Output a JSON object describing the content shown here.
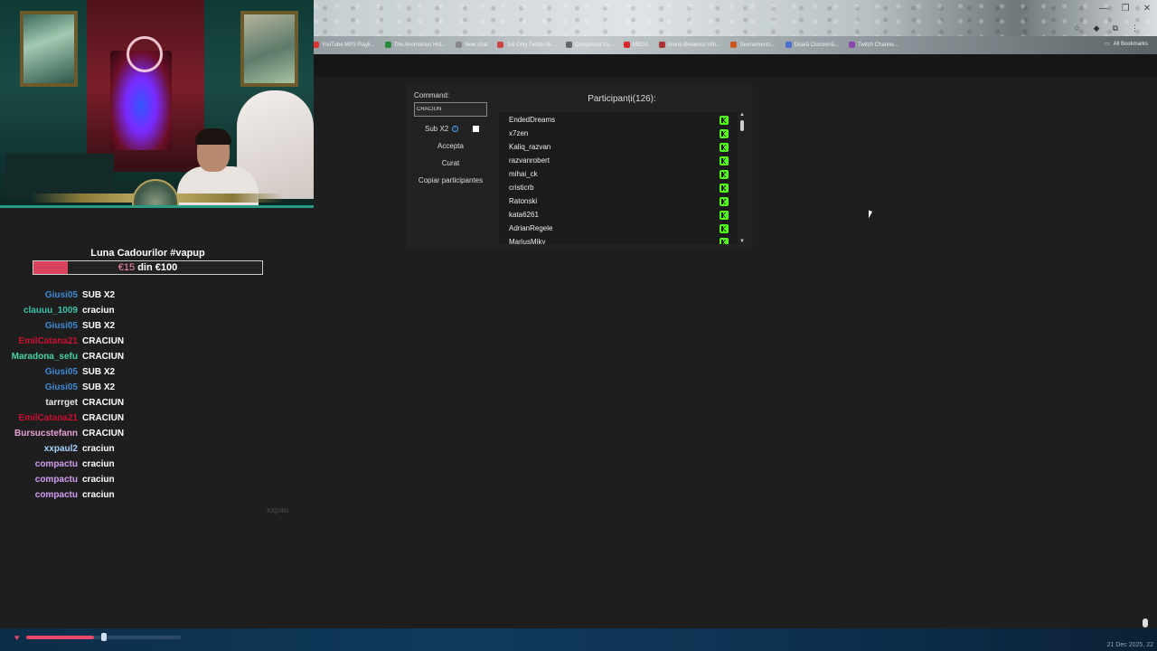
{
  "browser": {
    "bookmarks": [
      {
        "label": "YouTube MP3 Playli...",
        "color": "#d33"
      },
      {
        "label": "The Anomalous Hot...",
        "color": "#2a8a3a"
      },
      {
        "label": "New chat",
        "color": "#888"
      },
      {
        "label": "Tell Only Twitter lik...",
        "color": "#c44"
      },
      {
        "label": "Compound tra...",
        "color": "#666"
      },
      {
        "label": "MEGA",
        "color": "#d9272e"
      },
      {
        "label": "Arena Breakout Info...",
        "color": "#a33"
      },
      {
        "label": "Tournaments...",
        "color": "#c52"
      },
      {
        "label": "Doară Ciocovină...",
        "color": "#4a6fd0"
      },
      {
        "label": "Twitch Channe...",
        "color": "#8e44ad"
      }
    ],
    "all_bookmarks_label": "All Bookmarks"
  },
  "goal": {
    "title": "Luna Cadourilor #vapup",
    "current": "€15",
    "rest": " din €100",
    "progress": 0.15,
    "fill_color": "#d9435f"
  },
  "chat": [
    {
      "user": "Giusi05",
      "msg": "SUB X2",
      "color": "#3d8bd6"
    },
    {
      "user": "clauuu_1009",
      "msg": "craciun",
      "color": "#3fc1a8"
    },
    {
      "user": "Giusi05",
      "msg": "SUB X2",
      "color": "#3d8bd6"
    },
    {
      "user": "EmilCatana21",
      "msg": "CRACIUN",
      "color": "#c8102e"
    },
    {
      "user": "Maradona_sefu",
      "msg": "CRACIUN",
      "color": "#45d4a0"
    },
    {
      "user": "Giusi05",
      "msg": "SUB X2",
      "color": "#3d8bd6"
    },
    {
      "user": "Giusi05",
      "msg": "SUB X2",
      "color": "#3d8bd6"
    },
    {
      "user": "tarrrget",
      "msg": "CRACIUN",
      "color": "#e8e8e8"
    },
    {
      "user": "EmilCatana21",
      "msg": "CRACIUN",
      "color": "#c8102e"
    },
    {
      "user": "Bursucstefann",
      "msg": "CRACIUN",
      "color": "#e8a0d8"
    },
    {
      "user": "xxpaul2",
      "msg": "craciun",
      "color": "#a6d3ff"
    },
    {
      "user": "compactu",
      "msg": "craciun",
      "color": "#d59cf5"
    },
    {
      "user": "compactu",
      "msg": "craciun",
      "color": "#d59cf5"
    },
    {
      "user": "compactu",
      "msg": "craciun",
      "color": "#d59cf5"
    }
  ],
  "typing_indicator": "xxpau",
  "panel": {
    "command_label": "Command:",
    "command_value": "CRACIUN",
    "sub_label": "Sub X2",
    "accept_label": "Accepta",
    "clear_label": "Curat",
    "copy_label": "Copiar participantes",
    "participants_title": "Participanți(126):",
    "participants": [
      "EndedDreams",
      "x7zen",
      "Kaliq_razvan",
      "razvanrobert",
      "mihai_ck",
      "cristicrb",
      "Ratonski",
      "kata6261",
      "AdrianRegele",
      "MariusMiky"
    ],
    "kick_color": "#53fc18"
  },
  "taskbar": {
    "datetime": "21 Dec 2025, 22"
  }
}
